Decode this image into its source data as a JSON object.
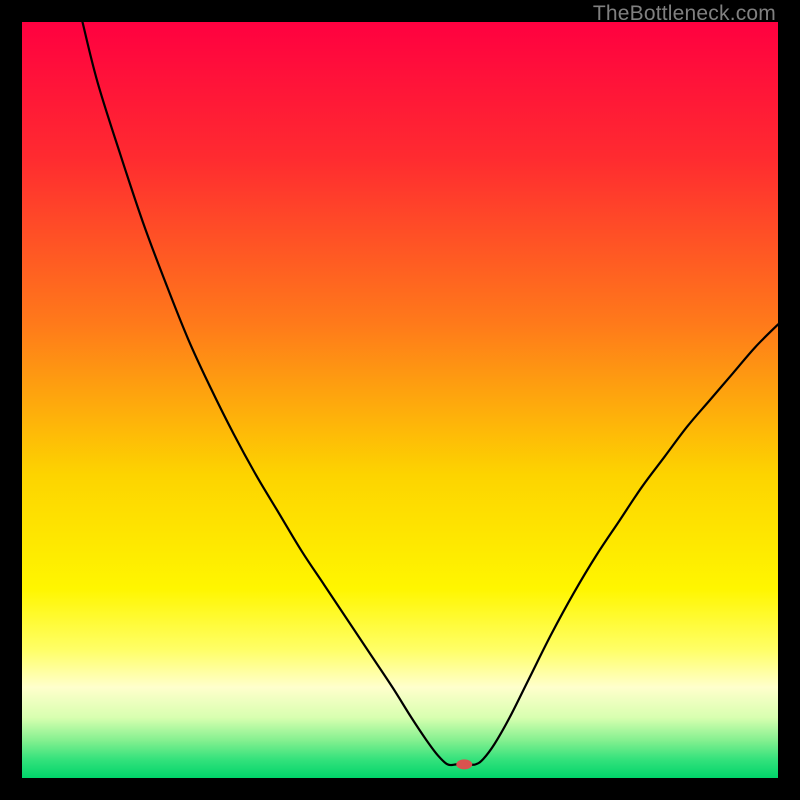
{
  "watermark": "TheBottleneck.com",
  "chart_data": {
    "type": "line",
    "title": "",
    "xlabel": "",
    "ylabel": "",
    "xlim": [
      0,
      100
    ],
    "ylim": [
      0,
      100
    ],
    "gradient_stops": [
      {
        "offset": 0,
        "color": "#ff0040"
      },
      {
        "offset": 18,
        "color": "#ff2b30"
      },
      {
        "offset": 40,
        "color": "#ff7a1a"
      },
      {
        "offset": 60,
        "color": "#fdd400"
      },
      {
        "offset": 75,
        "color": "#fff600"
      },
      {
        "offset": 83,
        "color": "#ffff66"
      },
      {
        "offset": 88,
        "color": "#ffffcc"
      },
      {
        "offset": 92,
        "color": "#d8ffb0"
      },
      {
        "offset": 95,
        "color": "#85f090"
      },
      {
        "offset": 97.5,
        "color": "#35e27c"
      },
      {
        "offset": 100,
        "color": "#00d46a"
      }
    ],
    "series": [
      {
        "name": "bottleneck-curve",
        "points": [
          {
            "x": 8.0,
            "y": 100.0
          },
          {
            "x": 10.0,
            "y": 92.0
          },
          {
            "x": 13.0,
            "y": 82.5
          },
          {
            "x": 16.0,
            "y": 73.5
          },
          {
            "x": 19.0,
            "y": 65.5
          },
          {
            "x": 22.0,
            "y": 58.0
          },
          {
            "x": 25.0,
            "y": 51.5
          },
          {
            "x": 28.0,
            "y": 45.5
          },
          {
            "x": 31.0,
            "y": 40.0
          },
          {
            "x": 34.0,
            "y": 35.0
          },
          {
            "x": 37.0,
            "y": 30.0
          },
          {
            "x": 40.0,
            "y": 25.5
          },
          {
            "x": 43.0,
            "y": 21.0
          },
          {
            "x": 46.0,
            "y": 16.5
          },
          {
            "x": 49.0,
            "y": 12.0
          },
          {
            "x": 51.5,
            "y": 8.0
          },
          {
            "x": 53.5,
            "y": 5.0
          },
          {
            "x": 55.0,
            "y": 3.0
          },
          {
            "x": 56.3,
            "y": 1.8
          },
          {
            "x": 57.5,
            "y": 1.8
          },
          {
            "x": 59.0,
            "y": 1.8
          },
          {
            "x": 60.0,
            "y": 1.8
          },
          {
            "x": 61.0,
            "y": 2.5
          },
          {
            "x": 62.5,
            "y": 4.5
          },
          {
            "x": 64.5,
            "y": 8.0
          },
          {
            "x": 67.0,
            "y": 13.0
          },
          {
            "x": 70.0,
            "y": 19.0
          },
          {
            "x": 73.0,
            "y": 24.5
          },
          {
            "x": 76.0,
            "y": 29.5
          },
          {
            "x": 79.0,
            "y": 34.0
          },
          {
            "x": 82.0,
            "y": 38.5
          },
          {
            "x": 85.0,
            "y": 42.5
          },
          {
            "x": 88.0,
            "y": 46.5
          },
          {
            "x": 91.0,
            "y": 50.0
          },
          {
            "x": 94.0,
            "y": 53.5
          },
          {
            "x": 97.0,
            "y": 57.0
          },
          {
            "x": 100.0,
            "y": 60.0
          }
        ]
      }
    ],
    "marker": {
      "x": 58.5,
      "y": 1.8,
      "color": "#d9534f",
      "rx": 8,
      "ry": 5
    }
  }
}
